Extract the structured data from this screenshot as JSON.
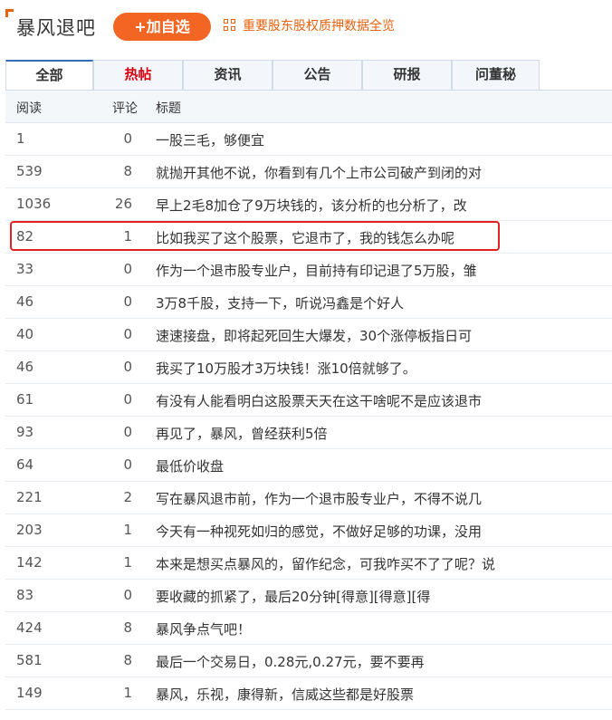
{
  "header": {
    "forum_title": "暴风退吧",
    "add_button": "+加自选",
    "pledge_icon": "grid-icon",
    "pledge_link": "重要股东股权质押数据全览"
  },
  "tabs": [
    {
      "label": "全部",
      "active": true
    },
    {
      "label": "热帖",
      "active": false
    },
    {
      "label": "资讯",
      "active": false
    },
    {
      "label": "公告",
      "active": false
    },
    {
      "label": "研报",
      "active": false
    },
    {
      "label": "问董秘",
      "active": false
    }
  ],
  "columns": {
    "reads": "阅读",
    "comments": "评论",
    "title": "标题"
  },
  "posts": [
    {
      "reads": "1",
      "comments": "0",
      "title": "一股三毛，够便宜"
    },
    {
      "reads": "539",
      "comments": "8",
      "title": "就抛开其他不说，你看到有几个上市公司破产到闭的对"
    },
    {
      "reads": "1036",
      "comments": "26",
      "title": "早上2毛8加仓了9万块钱的，该分析的也分析了，改"
    },
    {
      "reads": "82",
      "comments": "1",
      "title": "比如我买了这个股票，它退市了，我的钱怎么办呢"
    },
    {
      "reads": "33",
      "comments": "0",
      "title": "作为一个退市股专业户，目前持有印记退了5万股，雏"
    },
    {
      "reads": "46",
      "comments": "0",
      "title": "3万8千股，支持一下，听说冯鑫是个好人"
    },
    {
      "reads": "40",
      "comments": "0",
      "title": "速速接盘，即将起死回生大爆发，30个涨停板指日可"
    },
    {
      "reads": "46",
      "comments": "0",
      "title": "我买了10万股才3万块钱！涨10倍就够了。"
    },
    {
      "reads": "61",
      "comments": "0",
      "title": "有没有人能看明白这股票天天在这干啥呢不是应该退市"
    },
    {
      "reads": "93",
      "comments": "0",
      "title": "再见了，暴风，曾经获利5倍"
    },
    {
      "reads": "64",
      "comments": "0",
      "title": "最低价收盘"
    },
    {
      "reads": "221",
      "comments": "2",
      "title": "写在暴风退市前，作为一个退市股专业户，不得不说几"
    },
    {
      "reads": "203",
      "comments": "1",
      "title": "今天有一种视死如归的感觉，不做好足够的功课，没用"
    },
    {
      "reads": "142",
      "comments": "1",
      "title": "本来是想买点暴风的，留作纪念，可我咋买不了了呢？说"
    },
    {
      "reads": "83",
      "comments": "0",
      "title": "要收藏的抓紧了，最后20分钟[得意][得意][得"
    },
    {
      "reads": "424",
      "comments": "8",
      "title": "暴风争点气吧！"
    },
    {
      "reads": "581",
      "comments": "8",
      "title": "最后一个交易日，0.28元,0.27元，要不要再"
    },
    {
      "reads": "149",
      "comments": "1",
      "title": "暴风，乐视，康得新，信威这些都是好股票"
    }
  ],
  "colors": {
    "accent": "#f26522",
    "hot_tab": "#d7000f",
    "highlight_box": "#e02222"
  }
}
